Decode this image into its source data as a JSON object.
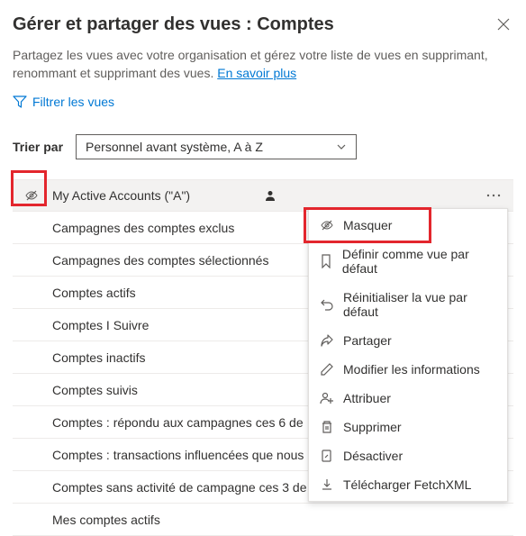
{
  "header": {
    "title": "Gérer et partager des vues : Comptes"
  },
  "subtitle": {
    "text": "Partagez les vues avec votre organisation et gérez votre liste de vues en supprimant, renommant et supprimant des vues. ",
    "link": "En savoir plus"
  },
  "filter": {
    "label": "Filtrer les vues"
  },
  "sort": {
    "label": "Trier par",
    "value": "Personnel avant système, A à Z"
  },
  "views": [
    "My Active Accounts (\"A\")",
    "Campagnes des comptes exclus",
    "Campagnes des comptes sélectionnés",
    "Comptes actifs",
    "Comptes I Suivre",
    "Comptes inactifs",
    "Comptes suivis",
    "Comptes : répondu aux campagnes ces 6 de",
    "Comptes : transactions influencées que nous",
    "Comptes sans activité de campagne ces 3 de",
    "Mes comptes actifs"
  ],
  "menu": {
    "hide": "Masquer",
    "setDefault": "Définir comme vue par défaut",
    "resetDefault": "Réinitialiser la vue par défaut",
    "share": "Partager",
    "editInfo": "Modifier les informations",
    "assign": "Attribuer",
    "delete": "Supprimer",
    "deactivate": "Désactiver",
    "downloadXml": "Télécharger FetchXML"
  }
}
